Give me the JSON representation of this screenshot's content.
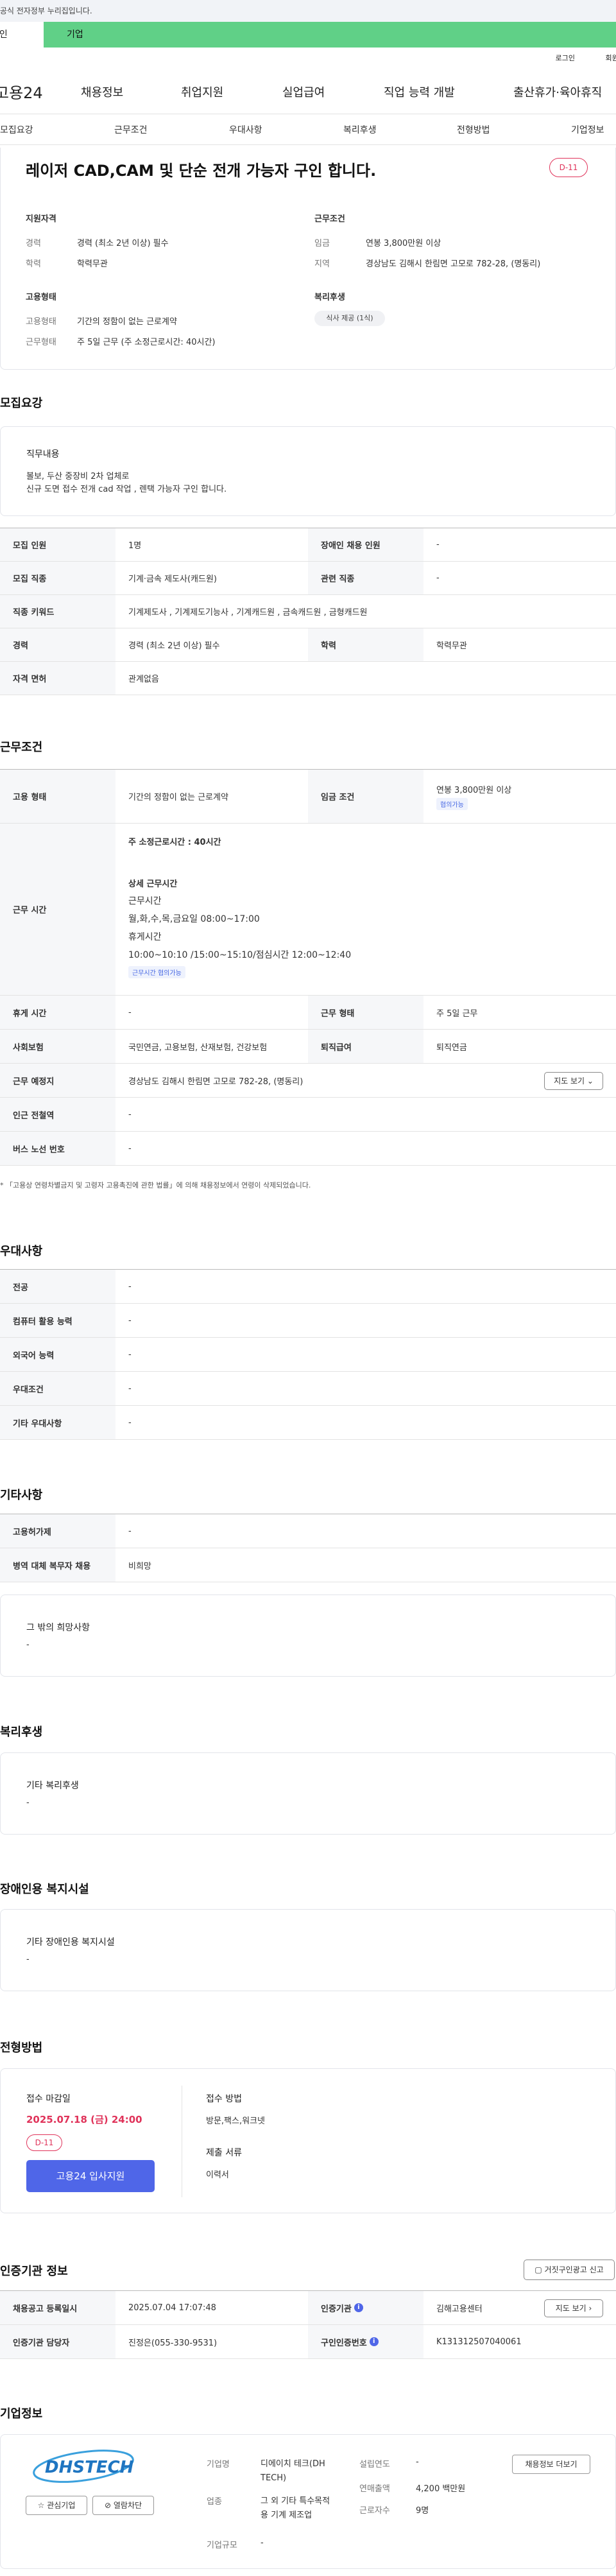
{
  "gov_notice": "공식 홈페이지 누리집은 대한민국 공식 전자정부 누리집입니다.",
  "tabs": {
    "personal": "개인",
    "company": "기업"
  },
  "util_links": {
    "login": "로그인",
    "join": "회원가입"
  },
  "logo": "고용24",
  "gnb": [
    "채용정보",
    "취업지원",
    "실업급여",
    "직업 능력 개발",
    "출산휴가·육아휴직"
  ],
  "subnav": [
    "모집요강",
    "근무조건",
    "우대사항",
    "복리후생",
    "전형방법",
    "기업정보"
  ],
  "summary": {
    "title": "레이저 CAD,CAM 및 단순 전개 가능자 구인 합니다.",
    "dday": "D-11",
    "qual_title": "지원자격",
    "qual": [
      {
        "label": "경력",
        "value": "경력 (최소 2년 이상) 필수"
      },
      {
        "label": "학력",
        "value": "학력무관"
      }
    ],
    "cond_title": "근무조건",
    "cond": [
      {
        "label": "임금",
        "value": "연봉 3,800만원 이상"
      },
      {
        "label": "지역",
        "value": "경상남도 김해시 한림면 고모로 782-28, (명동리)"
      }
    ],
    "emp_title": "고용형태",
    "emp": [
      {
        "label": "고용형태",
        "value": "기간의 정함이 없는 근로계약"
      },
      {
        "label": "근무형태",
        "value": "주 5일 근무 (주 소정근로시간: 40시간)"
      }
    ],
    "welfare_title": "복리후생",
    "welfare_chip": "식사 제공 (1식)"
  },
  "recruit": {
    "heading": "모집요강",
    "job_title": "직무내용",
    "job_desc": [
      "볼보, 두산 중장비 2차 업체로",
      "신규 도면 접수 전개 cad 작업 , 렌택 가능자  구인 합니다."
    ],
    "rows": [
      {
        "k1": "모집 인원",
        "v1": "1명",
        "k2": "장애인 채용 인원",
        "v2": "-"
      },
      {
        "k1": "모집 직종",
        "v1": "기계·금속 제도사(캐드원)",
        "k2": "관련 직종",
        "v2": "-"
      },
      {
        "k1": "직종 키워드",
        "v1": "기계제도사 , 기계제도기능사 , 기계캐드원 , 금속캐드원 , 금형캐드원"
      },
      {
        "k1": "경력",
        "v1": "경력 (최소 2년 이상) 필수",
        "k2": "학력",
        "v2": "학력무관"
      },
      {
        "k1": "자격 면허",
        "v1": "관계없음"
      }
    ]
  },
  "work": {
    "heading": "근무조건",
    "employ_type_k": "고용 형태",
    "employ_type_v": "기간의 정함이 없는 근로계약",
    "wage_k": "임금 조건",
    "wage_v": "연봉 3,800만원 이상",
    "wage_tag": "협의가능",
    "hours_k": "근무 시간",
    "hours_week": "주 소정근로시간 : 40시간",
    "hours_detail_title": "상세 근무시간",
    "hours_lines": [
      "근무시간",
      "월,화,수,목,금요일 08:00~17:00",
      "휴게시간",
      "10:00~10:10 /15:00~15:10/점심시간 12:00~12:40"
    ],
    "hours_tag": "근무시간 협의가능",
    "rest_k": "휴게 시간",
    "rest_v": "-",
    "worktype_k": "근무 형태",
    "worktype_v": "주 5일 근무",
    "insurance_k": "사회보험",
    "insurance_v": "국민연금, 고용보험, 산재보험, 건강보험",
    "retire_k": "퇴직급여",
    "retire_v": "퇴직연금",
    "place_k": "근무 예정지",
    "place_v": "경상남도 김해시 한림면 고모로 782-28, (명동리)",
    "map_btn": "지도 보기",
    "subway_k": "인근 전철역",
    "subway_v": "-",
    "bus_k": "버스 노선 번호",
    "bus_v": "-",
    "note": "* 「고용상 연령차별금지 및 고령자 고용촉진에 관한 법률」에 의해 채용정보에서 연령이 삭제되었습니다."
  },
  "pref": {
    "heading": "우대사항",
    "rows": [
      {
        "k": "전공",
        "v": "-"
      },
      {
        "k": "컴퓨터 활용 능력",
        "v": "-"
      },
      {
        "k": "외국어 능력",
        "v": "-"
      },
      {
        "k": "우대조건",
        "v": "-"
      },
      {
        "k": "기타 우대사항",
        "v": "-"
      }
    ]
  },
  "etc": {
    "heading": "기타사항",
    "rows": [
      {
        "k": "고용허가제",
        "v": "-"
      },
      {
        "k": "병역 대체 복무자 채용",
        "v": "비희망"
      }
    ],
    "box_title": "그 밖의 희망사항",
    "box_value": "-"
  },
  "welfare": {
    "heading": "복리후생",
    "box_title": "기타 복리후생",
    "box_value": "-"
  },
  "disabled": {
    "heading": "장애인용 복지시설",
    "box_title": "기타 장애인용 복지시설",
    "box_value": "-"
  },
  "selection": {
    "heading": "전형방법",
    "deadline_title": "접수 마감일",
    "deadline": "2025.07.18 (금) 24:00",
    "dday": "D-11",
    "apply_btn": "고용24 입사지원",
    "method_title": "접수 방법",
    "method": "방문,팩스,워크넷",
    "docs_title": "제출 서류",
    "docs": "이력서"
  },
  "agency": {
    "heading": "인증기관 정보",
    "report_btn": "거짓구인광고 신고",
    "rows": [
      {
        "k1": "채용공고 등록일시",
        "v1": "2025.07.04 17:07:48",
        "k2": "인증기관",
        "v2": "김해고용센터"
      },
      {
        "k1": "인증기관 담당자",
        "v1": "진정은(055-330-9531)",
        "k2": "구인인증번호",
        "v2": "K131312507040061"
      }
    ],
    "map_btn": "지도 보기"
  },
  "company": {
    "heading": "기업정보",
    "logo_text": "DHSTECH",
    "fav_btn": "관심기업",
    "block_btn": "열람차단",
    "rows": [
      {
        "k": "기업명",
        "v": "디에이치 테크(DH TECH)"
      },
      {
        "k": "업종",
        "v": "그 외 기타 특수목적용 기계 제조업"
      },
      {
        "k": "기업규모",
        "v": "-"
      }
    ],
    "rows2": [
      {
        "k": "설립연도",
        "v": "-"
      },
      {
        "k": "연매출액",
        "v": "4,200 백만원"
      },
      {
        "k": "근로자수",
        "v": "9명"
      }
    ],
    "reg_btn": "채용정보 더보기"
  }
}
